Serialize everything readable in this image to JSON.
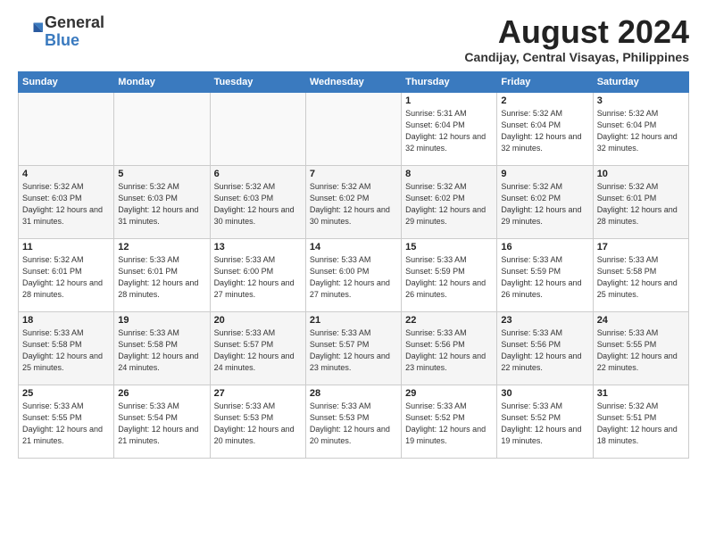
{
  "header": {
    "logo_general": "General",
    "logo_blue": "Blue",
    "month_title": "August 2024",
    "location": "Candijay, Central Visayas, Philippines"
  },
  "weekdays": [
    "Sunday",
    "Monday",
    "Tuesday",
    "Wednesday",
    "Thursday",
    "Friday",
    "Saturday"
  ],
  "weeks": [
    [
      {
        "day": "",
        "sunrise": "",
        "sunset": "",
        "daylight": ""
      },
      {
        "day": "",
        "sunrise": "",
        "sunset": "",
        "daylight": ""
      },
      {
        "day": "",
        "sunrise": "",
        "sunset": "",
        "daylight": ""
      },
      {
        "day": "",
        "sunrise": "",
        "sunset": "",
        "daylight": ""
      },
      {
        "day": "1",
        "sunrise": "Sunrise: 5:31 AM",
        "sunset": "Sunset: 6:04 PM",
        "daylight": "Daylight: 12 hours and 32 minutes."
      },
      {
        "day": "2",
        "sunrise": "Sunrise: 5:32 AM",
        "sunset": "Sunset: 6:04 PM",
        "daylight": "Daylight: 12 hours and 32 minutes."
      },
      {
        "day": "3",
        "sunrise": "Sunrise: 5:32 AM",
        "sunset": "Sunset: 6:04 PM",
        "daylight": "Daylight: 12 hours and 32 minutes."
      }
    ],
    [
      {
        "day": "4",
        "sunrise": "Sunrise: 5:32 AM",
        "sunset": "Sunset: 6:03 PM",
        "daylight": "Daylight: 12 hours and 31 minutes."
      },
      {
        "day": "5",
        "sunrise": "Sunrise: 5:32 AM",
        "sunset": "Sunset: 6:03 PM",
        "daylight": "Daylight: 12 hours and 31 minutes."
      },
      {
        "day": "6",
        "sunrise": "Sunrise: 5:32 AM",
        "sunset": "Sunset: 6:03 PM",
        "daylight": "Daylight: 12 hours and 30 minutes."
      },
      {
        "day": "7",
        "sunrise": "Sunrise: 5:32 AM",
        "sunset": "Sunset: 6:02 PM",
        "daylight": "Daylight: 12 hours and 30 minutes."
      },
      {
        "day": "8",
        "sunrise": "Sunrise: 5:32 AM",
        "sunset": "Sunset: 6:02 PM",
        "daylight": "Daylight: 12 hours and 29 minutes."
      },
      {
        "day": "9",
        "sunrise": "Sunrise: 5:32 AM",
        "sunset": "Sunset: 6:02 PM",
        "daylight": "Daylight: 12 hours and 29 minutes."
      },
      {
        "day": "10",
        "sunrise": "Sunrise: 5:32 AM",
        "sunset": "Sunset: 6:01 PM",
        "daylight": "Daylight: 12 hours and 28 minutes."
      }
    ],
    [
      {
        "day": "11",
        "sunrise": "Sunrise: 5:32 AM",
        "sunset": "Sunset: 6:01 PM",
        "daylight": "Daylight: 12 hours and 28 minutes."
      },
      {
        "day": "12",
        "sunrise": "Sunrise: 5:33 AM",
        "sunset": "Sunset: 6:01 PM",
        "daylight": "Daylight: 12 hours and 28 minutes."
      },
      {
        "day": "13",
        "sunrise": "Sunrise: 5:33 AM",
        "sunset": "Sunset: 6:00 PM",
        "daylight": "Daylight: 12 hours and 27 minutes."
      },
      {
        "day": "14",
        "sunrise": "Sunrise: 5:33 AM",
        "sunset": "Sunset: 6:00 PM",
        "daylight": "Daylight: 12 hours and 27 minutes."
      },
      {
        "day": "15",
        "sunrise": "Sunrise: 5:33 AM",
        "sunset": "Sunset: 5:59 PM",
        "daylight": "Daylight: 12 hours and 26 minutes."
      },
      {
        "day": "16",
        "sunrise": "Sunrise: 5:33 AM",
        "sunset": "Sunset: 5:59 PM",
        "daylight": "Daylight: 12 hours and 26 minutes."
      },
      {
        "day": "17",
        "sunrise": "Sunrise: 5:33 AM",
        "sunset": "Sunset: 5:58 PM",
        "daylight": "Daylight: 12 hours and 25 minutes."
      }
    ],
    [
      {
        "day": "18",
        "sunrise": "Sunrise: 5:33 AM",
        "sunset": "Sunset: 5:58 PM",
        "daylight": "Daylight: 12 hours and 25 minutes."
      },
      {
        "day": "19",
        "sunrise": "Sunrise: 5:33 AM",
        "sunset": "Sunset: 5:58 PM",
        "daylight": "Daylight: 12 hours and 24 minutes."
      },
      {
        "day": "20",
        "sunrise": "Sunrise: 5:33 AM",
        "sunset": "Sunset: 5:57 PM",
        "daylight": "Daylight: 12 hours and 24 minutes."
      },
      {
        "day": "21",
        "sunrise": "Sunrise: 5:33 AM",
        "sunset": "Sunset: 5:57 PM",
        "daylight": "Daylight: 12 hours and 23 minutes."
      },
      {
        "day": "22",
        "sunrise": "Sunrise: 5:33 AM",
        "sunset": "Sunset: 5:56 PM",
        "daylight": "Daylight: 12 hours and 23 minutes."
      },
      {
        "day": "23",
        "sunrise": "Sunrise: 5:33 AM",
        "sunset": "Sunset: 5:56 PM",
        "daylight": "Daylight: 12 hours and 22 minutes."
      },
      {
        "day": "24",
        "sunrise": "Sunrise: 5:33 AM",
        "sunset": "Sunset: 5:55 PM",
        "daylight": "Daylight: 12 hours and 22 minutes."
      }
    ],
    [
      {
        "day": "25",
        "sunrise": "Sunrise: 5:33 AM",
        "sunset": "Sunset: 5:55 PM",
        "daylight": "Daylight: 12 hours and 21 minutes."
      },
      {
        "day": "26",
        "sunrise": "Sunrise: 5:33 AM",
        "sunset": "Sunset: 5:54 PM",
        "daylight": "Daylight: 12 hours and 21 minutes."
      },
      {
        "day": "27",
        "sunrise": "Sunrise: 5:33 AM",
        "sunset": "Sunset: 5:53 PM",
        "daylight": "Daylight: 12 hours and 20 minutes."
      },
      {
        "day": "28",
        "sunrise": "Sunrise: 5:33 AM",
        "sunset": "Sunset: 5:53 PM",
        "daylight": "Daylight: 12 hours and 20 minutes."
      },
      {
        "day": "29",
        "sunrise": "Sunrise: 5:33 AM",
        "sunset": "Sunset: 5:52 PM",
        "daylight": "Daylight: 12 hours and 19 minutes."
      },
      {
        "day": "30",
        "sunrise": "Sunrise: 5:33 AM",
        "sunset": "Sunset: 5:52 PM",
        "daylight": "Daylight: 12 hours and 19 minutes."
      },
      {
        "day": "31",
        "sunrise": "Sunrise: 5:32 AM",
        "sunset": "Sunset: 5:51 PM",
        "daylight": "Daylight: 12 hours and 18 minutes."
      }
    ]
  ]
}
